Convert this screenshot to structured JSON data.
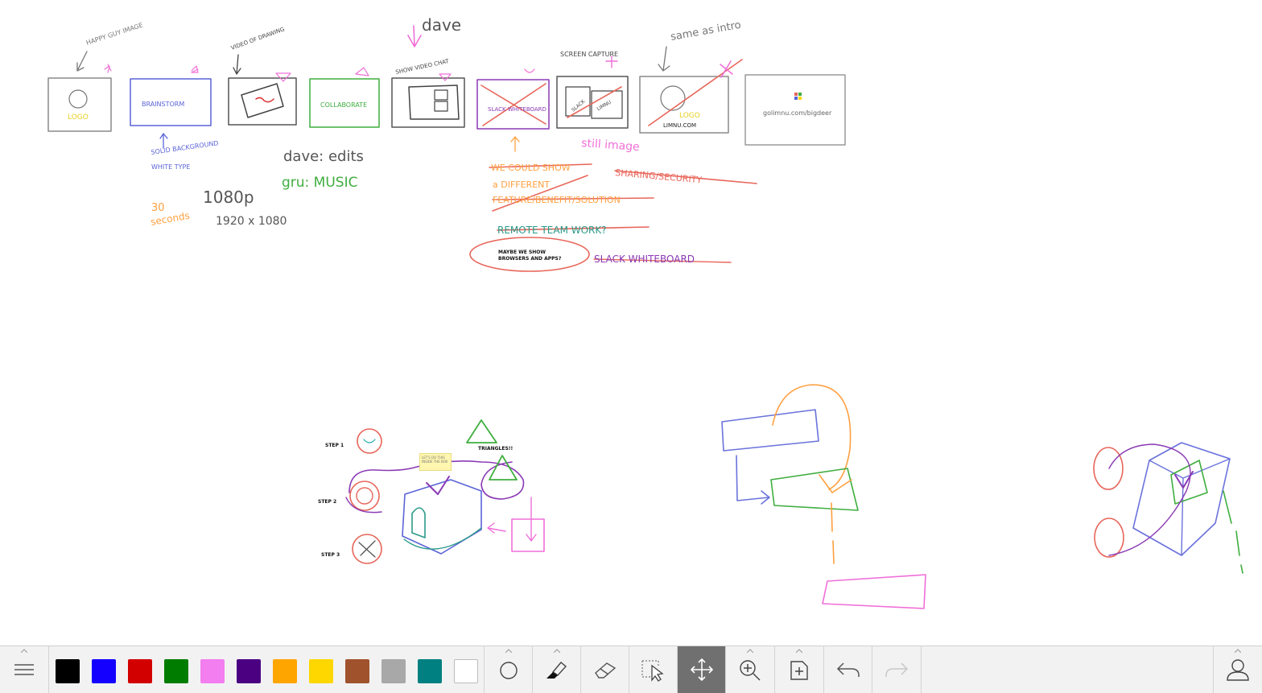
{
  "board": {
    "top_notes": {
      "happy_guy": "HAPPY GUY IMAGE",
      "video_of_drawing": "VIDEO OF DRAWING",
      "dave": "dave",
      "show_video_chat": "SHOW VIDEO CHAT",
      "screen_capture": "SCREEN CAPTURE",
      "same_as_intro": "same as intro"
    },
    "frames": {
      "logo1": "LOGO",
      "brainstorm": "BRAINSTORM",
      "collaborate": "COLLABORATE",
      "slack_whiteboard": "SLACK WHITEBOARD",
      "slack": "SLACK",
      "limnu_small": "LIMNU",
      "logo2": "LOGO",
      "limnu_com": "LIMNU.COM",
      "url": "golimnu.com/bigdeer"
    },
    "annotations": {
      "solid_bg": "SOLID BACKGROUND",
      "white_type": "WHITE TYPE",
      "dave_edits": "dave: edits",
      "gru_music": "gru: MUSIC",
      "thirty": "30",
      "seconds": "seconds",
      "res1": "1080p",
      "res2": "1920 x 1080",
      "still_image": "still image",
      "we_could_show": "WE COULD SHOW",
      "a_different": "a DIFFERENT",
      "feature": "FEATURE/BENEFIT/SOLUTION",
      "sharing": "SHARING/SECURITY",
      "remote": "REMOTE TEAM WORK?",
      "maybe1": "MAYBE WE SHOW",
      "maybe2": "BROWSERS AND APPS?",
      "slack_wb": "SLACK WHITEBOARD"
    },
    "steps": {
      "step1": "STEP 1",
      "step2": "STEP 2",
      "step3": "STEP 3",
      "triangles": "TRIANGLES!!"
    },
    "sticky_note": "LET'S DO THIS INSIDE THE BOX"
  },
  "toolbar": {
    "colors": [
      "#000000",
      "#1400ff",
      "#d30000",
      "#007d00",
      "#f37ef0",
      "#4b0082",
      "#ffa500",
      "#ffd700",
      "#a0522d",
      "#a8a8a8",
      "#008080",
      "#ffffff"
    ],
    "color_names": [
      "black",
      "blue",
      "red",
      "green",
      "pink",
      "indigo",
      "orange",
      "gold",
      "brown",
      "gray",
      "teal",
      "white"
    ],
    "tools": [
      {
        "name": "menu-icon"
      },
      {
        "name": "shape-circle-icon"
      },
      {
        "name": "marker-icon"
      },
      {
        "name": "eraser-icon"
      },
      {
        "name": "select-pointer-icon"
      },
      {
        "name": "move-arrows-icon",
        "active": true
      },
      {
        "name": "zoom-in-icon"
      },
      {
        "name": "add-board-icon"
      },
      {
        "name": "undo-icon"
      },
      {
        "name": "redo-icon"
      },
      {
        "name": "user-icon"
      }
    ]
  }
}
